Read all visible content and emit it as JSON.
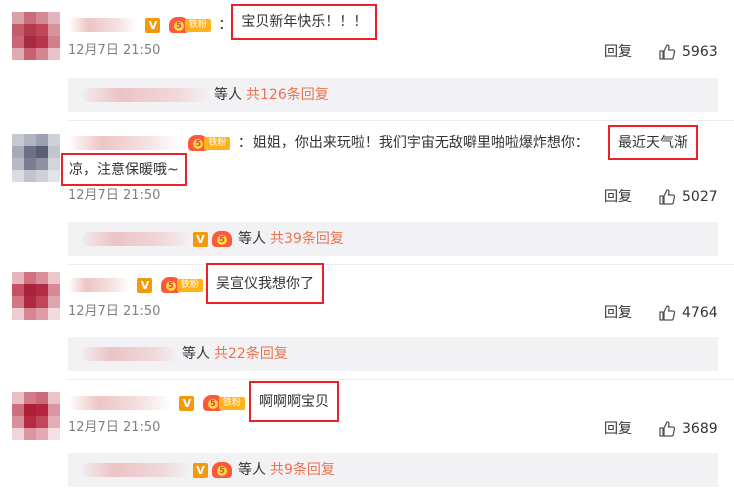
{
  "comments": [
    {
      "text": "宝贝新年快乐！！！",
      "time": "12月7日 21:50",
      "reply_label": "回复",
      "likes": "5963",
      "fan_label": "铁粉",
      "sub_wait": "等人",
      "sub_total": "共126条回复"
    },
    {
      "text_part1": "姐姐，你出来玩啦！我们宇宙无敌噼里啪啦爆炸想你：",
      "text_hl1": "最近天气渐",
      "text_hl2": "凉，注意保暖哦~",
      "time": "12月7日 21:50",
      "reply_label": "回复",
      "likes": "5027",
      "fan_label": "铁粉",
      "sub_wait": "等人",
      "sub_total": "共39条回复"
    },
    {
      "text": "吴宣仪我想你了",
      "time": "12月7日 21:50",
      "reply_label": "回复",
      "likes": "4764",
      "fan_label": "铁粉",
      "sub_wait": "等人",
      "sub_total": "共22条回复"
    },
    {
      "text": "啊啊啊宝贝",
      "time": "12月7日 21:50",
      "reply_label": "回复",
      "likes": "3689",
      "fan_label": "铁粉",
      "sub_wait": "等人",
      "sub_total": "共9条回复"
    }
  ],
  "icons": {
    "like": "thumbs-up-icon",
    "verified": "v-badge-icon",
    "fan": "fan-crown-icon"
  },
  "colors": {
    "highlight_border": "#e8212a",
    "reply_count": "#eb7350",
    "v_badge": "#f29a0b"
  }
}
